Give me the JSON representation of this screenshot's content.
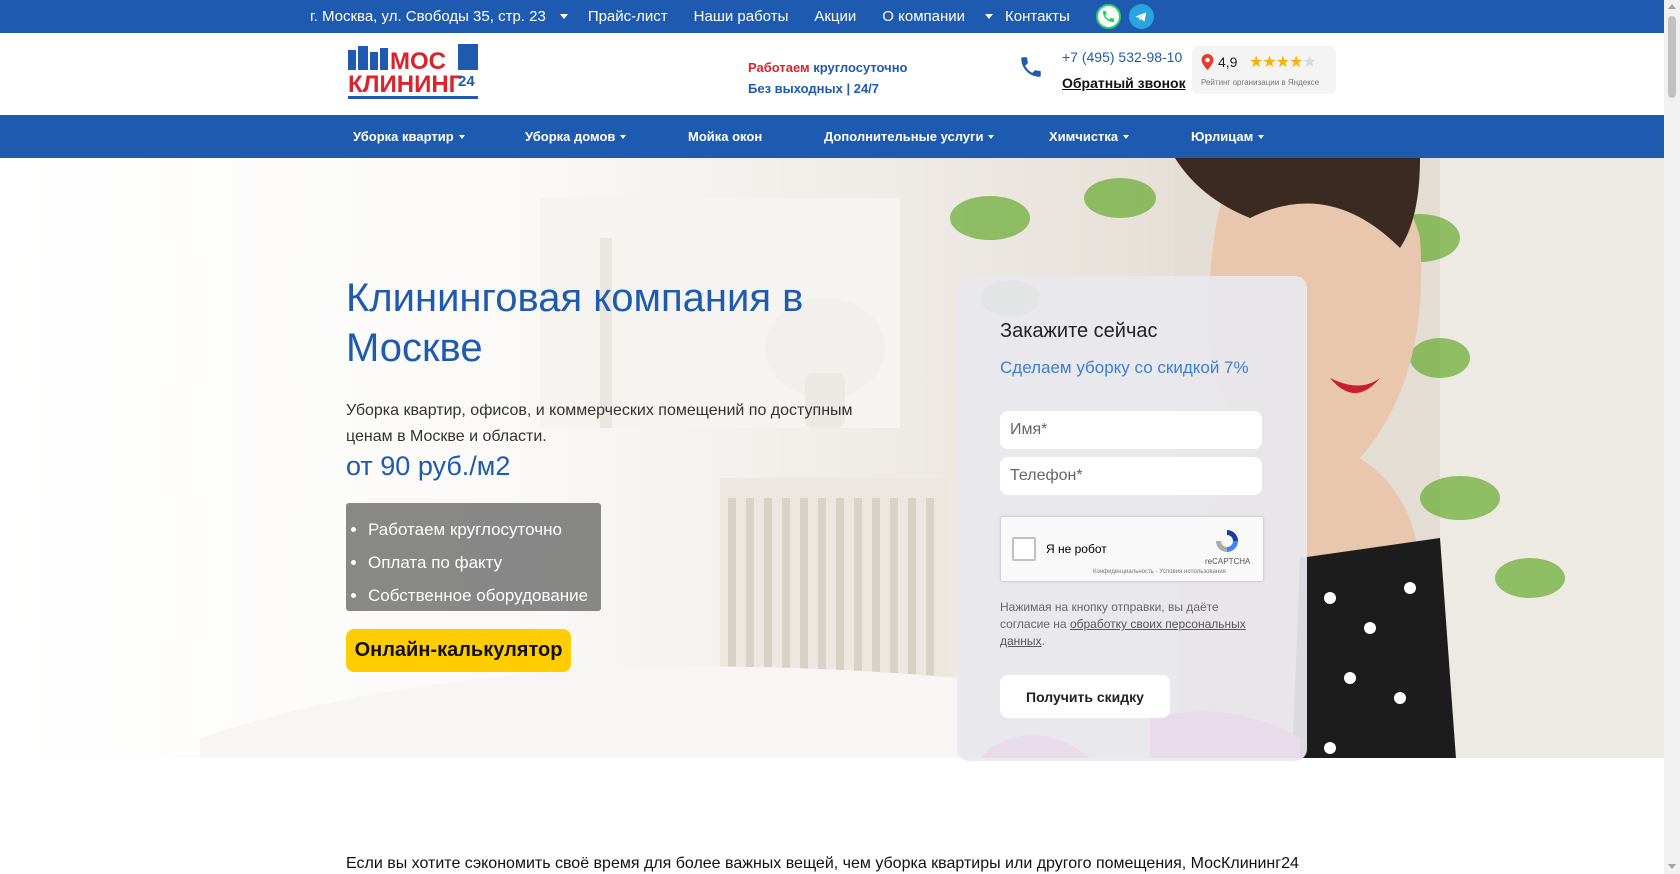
{
  "topbar": {
    "address": "г. Москва, ул. Свободы 35, стр. 23",
    "items": [
      "Прайс-лист",
      "Наши работы",
      "Акции",
      "О компании",
      "Контакты"
    ]
  },
  "header": {
    "logo": {
      "line1": "МОС",
      "line2": "КЛИНИНГ",
      "badge": "24"
    },
    "work_red": "Работаем",
    "work_blue": " круглосуточно",
    "work_sub": "Без выходных | 24/7",
    "phone": "+7 (495) 532-98-10",
    "callback": "Обратный звонок",
    "rating": {
      "value": "4,9",
      "stars": 4.5,
      "caption": "Рейтинг организации в Яндексе"
    }
  },
  "nav": {
    "items": [
      {
        "label": "Уборка квартир"
      },
      {
        "label": "Уборка домов"
      },
      {
        "label": "Мойка окон"
      },
      {
        "label": "Дополнительные услуги"
      },
      {
        "label": "Химчистка"
      },
      {
        "label": "Юрлицам"
      }
    ]
  },
  "hero": {
    "title": "Клининговая компания в Москве",
    "lead": "Уборка квартир, офисов, и коммерческих помещений по доступным ценам в Москве и области.",
    "price": "от 90 руб./м2",
    "benefits": [
      "Работаем круглосуточно",
      "Оплата по факту",
      "Собственное оборудование"
    ],
    "calc_button": "Онлайн-калькулятор"
  },
  "form": {
    "title": "Закажите сейчас",
    "subtitle": "Сделаем уборку со скидкой 7%",
    "name_placeholder": "Имя*",
    "phone_placeholder": "Телефон*",
    "captcha_label": "Я не робот",
    "captcha_brand": "reCAPTCHA",
    "captcha_links": "Конфиденциальность - Условия использования",
    "consent_prefix": "Нажимая на кнопку отправки, вы даёте согласие на ",
    "consent_link": "обработку своих персональных данных",
    "consent_suffix": ".",
    "submit": "Получить скидку"
  },
  "bottom_text": "Если вы хотите сэкономить своё время для более важных вещей, чем уборка квартиры или другого помещения, МосКлининг24",
  "colors": {
    "brand_blue": "#1e5bb0",
    "accent_yellow": "#ffcd00",
    "accent_red": "#d9232d"
  }
}
